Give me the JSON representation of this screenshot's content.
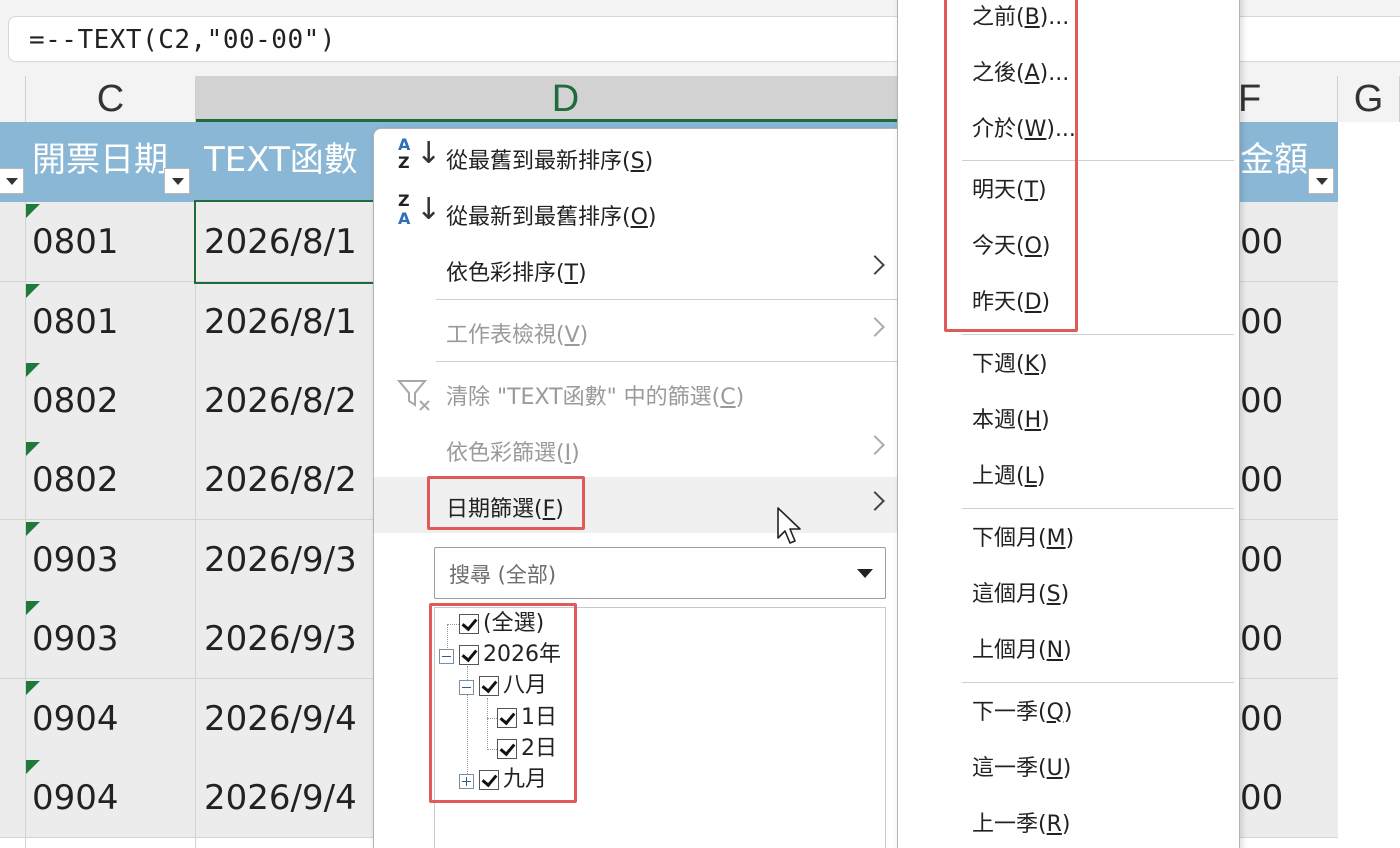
{
  "formula_bar": {
    "formula": "=--TEXT(C2,\"00-00\")"
  },
  "columns": {
    "c": "C",
    "d": "D",
    "f": "F",
    "g": "G"
  },
  "table_header": {
    "col_c": "開票日期",
    "col_d": "TEXT函數",
    "col_f": "金額"
  },
  "rows": [
    {
      "c": "0801",
      "d": "2026/8/1",
      "f": "00"
    },
    {
      "c": "0801",
      "d": "2026/8/1",
      "f": "00"
    },
    {
      "c": "0802",
      "d": "2026/8/2",
      "f": "00"
    },
    {
      "c": "0802",
      "d": "2026/8/2",
      "f": "00"
    },
    {
      "c": "0903",
      "d": "2026/9/3",
      "f": "00"
    },
    {
      "c": "0903",
      "d": "2026/9/3",
      "f": "00"
    },
    {
      "c": "0904",
      "d": "2026/9/4",
      "f": "00"
    },
    {
      "c": "0904",
      "d": "2026/9/4",
      "f": "00"
    }
  ],
  "menu": {
    "sort_asc": {
      "pre": "從最舊到最新排序(",
      "key": "S",
      "post": ")"
    },
    "sort_desc": {
      "pre": "從最新到最舊排序(",
      "key": "O",
      "post": ")"
    },
    "sort_color": {
      "pre": "依色彩排序(",
      "key": "T",
      "post": ")"
    },
    "sheet_view": {
      "pre": "工作表檢視(",
      "key": "V",
      "post": ")"
    },
    "clear_filter": {
      "pre": "清除 \"TEXT函數\" 中的篩選(",
      "key": "C",
      "post": ")"
    },
    "color_filter": {
      "pre": "依色彩篩選(",
      "key": "I",
      "post": ")"
    },
    "date_filter": {
      "pre": "日期篩選(",
      "key": "F",
      "post": ")"
    },
    "search_placeholder": "搜尋 (全部)",
    "tree": {
      "select_all": "(全選)",
      "year": "2026年",
      "month_aug": "八月",
      "day1": "1日",
      "day2": "2日",
      "month_sep": "九月"
    }
  },
  "submenu": {
    "before": {
      "pre": "之前(",
      "key": "B",
      "post": ")..."
    },
    "after": {
      "pre": "之後(",
      "key": "A",
      "post": ")..."
    },
    "between": {
      "pre": "介於(",
      "key": "W",
      "post": ")..."
    },
    "tomorrow": {
      "pre": "明天(",
      "key": "T",
      "post": ")"
    },
    "today": {
      "pre": "今天(",
      "key": "O",
      "post": ")"
    },
    "yesterday": {
      "pre": "昨天(",
      "key": "D",
      "post": ")"
    },
    "next_week": {
      "pre": "下週(",
      "key": "K",
      "post": ")"
    },
    "this_week": {
      "pre": "本週(",
      "key": "H",
      "post": ")"
    },
    "last_week": {
      "pre": "上週(",
      "key": "L",
      "post": ")"
    },
    "next_month": {
      "pre": "下個月(",
      "key": "M",
      "post": ")"
    },
    "this_month": {
      "pre": "這個月(",
      "key": "S",
      "post": ")"
    },
    "last_month": {
      "pre": "上個月(",
      "key": "N",
      "post": ")"
    },
    "next_quarter": {
      "pre": "下一季(",
      "key": "Q",
      "post": ")"
    },
    "this_quarter": {
      "pre": "這一季(",
      "key": "U",
      "post": ")"
    },
    "last_quarter": {
      "pre": "上一季(",
      "key": "R",
      "post": ")"
    }
  },
  "colors": {
    "header_fill": "#8ab7d6",
    "excel_green": "#1e6b3c",
    "highlight_red": "#e05a5a",
    "row_fill": "#ececec"
  },
  "icons": {
    "sort_asc": "sort-ascending-icon",
    "sort_desc": "sort-descending-icon",
    "clear_filter": "clear-filter-icon",
    "cursor": "mouse-pointer-icon"
  }
}
